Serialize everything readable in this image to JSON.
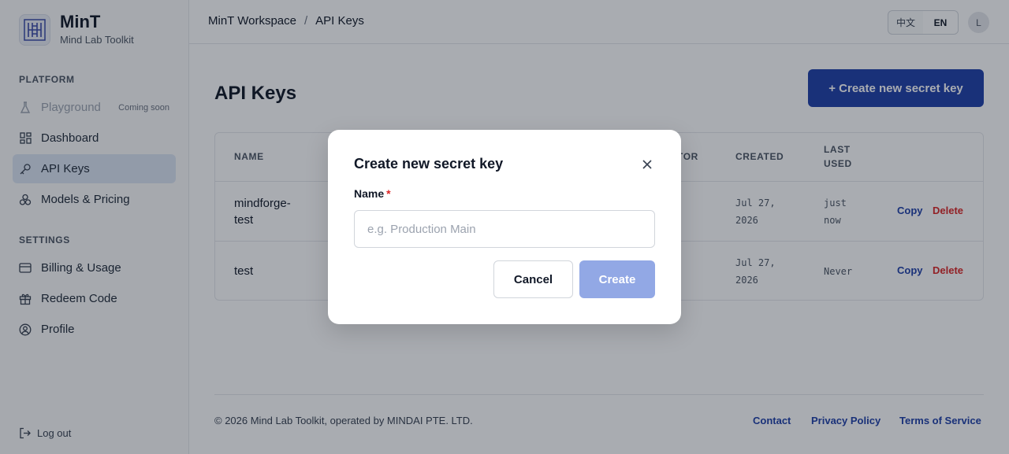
{
  "brand": {
    "title": "MinT",
    "subtitle": "Mind Lab Toolkit"
  },
  "sidebar": {
    "platform_label": "PLATFORM",
    "settings_label": "SETTINGS",
    "items": [
      {
        "label": "Playground",
        "badge": "Coming soon",
        "icon": "flask-icon"
      },
      {
        "label": "Dashboard",
        "icon": "dashboard-icon"
      },
      {
        "label": "API Keys",
        "icon": "key-icon"
      },
      {
        "label": "Models & Pricing",
        "icon": "models-icon"
      },
      {
        "label": "Billing & Usage",
        "icon": "card-icon"
      },
      {
        "label": "Redeem Code",
        "icon": "gift-icon"
      },
      {
        "label": "Profile",
        "icon": "user-circle-icon"
      }
    ],
    "logout_label": "Log out"
  },
  "topbar": {
    "breadcrumb": [
      "MinT Workspace",
      "API Keys"
    ],
    "separator": "/",
    "lang_zh": "中文",
    "lang_en": "EN",
    "avatar_initial": "L"
  },
  "main": {
    "title": "API Keys",
    "create_button": "+ Create new secret key",
    "table": {
      "headers": {
        "name": "NAME",
        "creator": "TOR",
        "created": "CREATED",
        "last_used_1": "LAST",
        "last_used_2": "USED"
      },
      "rows": [
        {
          "name_1": "mindforge-",
          "name_2": "test",
          "created_1": "Jul 27,",
          "created_2": "2026",
          "last_1": "just",
          "last_2": "now",
          "copy": "Copy",
          "delete": "Delete"
        },
        {
          "name_1": "test",
          "name_2": "",
          "created_1": "Jul 27,",
          "created_2": "2026",
          "last_1": "Never",
          "last_2": "",
          "copy": "Copy",
          "delete": "Delete"
        }
      ]
    }
  },
  "footer": {
    "copyright": "© 2026 Mind Lab Toolkit, operated by MINDAI PTE. LTD.",
    "links": [
      "Contact",
      "Privacy Policy",
      "Terms of Service"
    ]
  },
  "modal": {
    "title": "Create new secret key",
    "name_label": "Name",
    "required_mark": "*",
    "name_placeholder": "e.g. Production Main",
    "name_value": "",
    "cancel": "Cancel",
    "create": "Create"
  },
  "colors": {
    "primary": "#1f3fa8",
    "primary_disabled": "#92a8e5",
    "danger": "#dc2626",
    "active_nav": "#dbe4f3"
  }
}
